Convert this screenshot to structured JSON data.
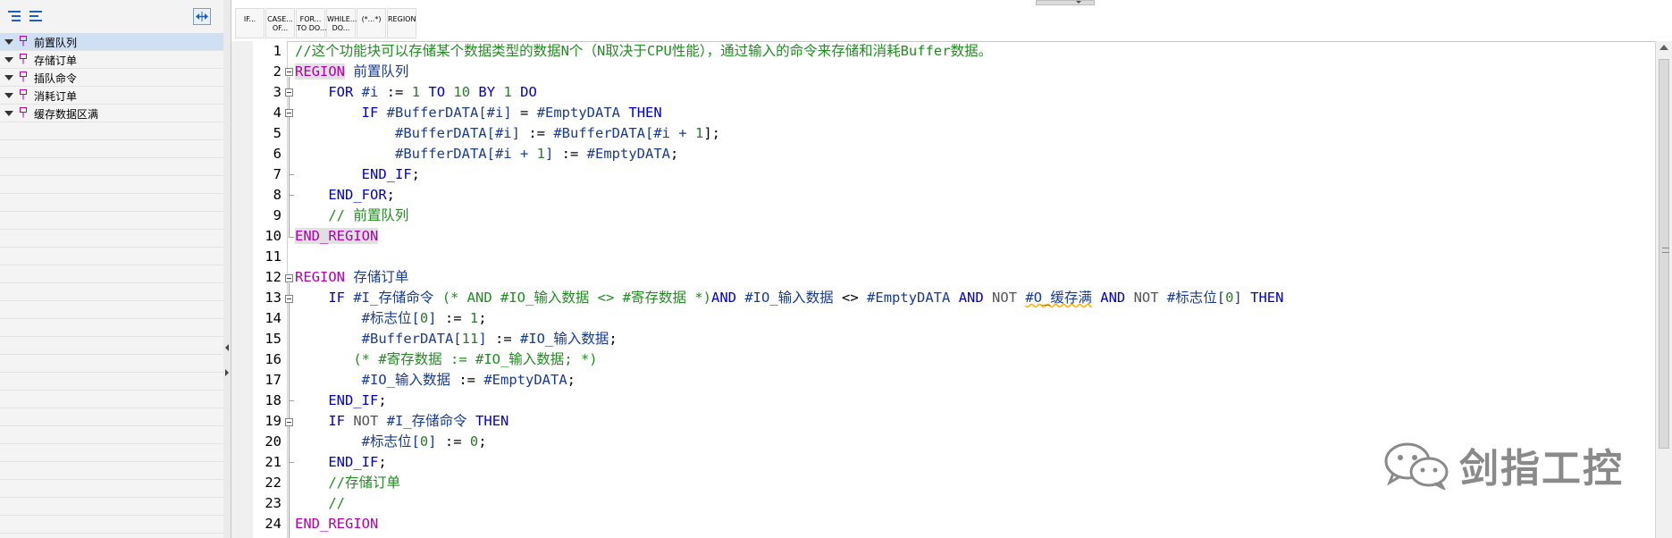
{
  "regions": [
    {
      "label": "前置队列",
      "selected": true
    },
    {
      "label": "存储订单",
      "selected": false
    },
    {
      "label": "插队命令",
      "selected": false
    },
    {
      "label": "消耗订单",
      "selected": false
    },
    {
      "label": "缓存数据区满",
      "selected": false
    }
  ],
  "instructions": [
    "IF...",
    "CASE...\nOF...",
    "FOR...\nTO DO...",
    "WHILE...\nDO...",
    "(*...*)",
    "REGION"
  ],
  "line_numbers": [
    "1",
    "2",
    "3",
    "4",
    "5",
    "6",
    "7",
    "8",
    "9",
    "10",
    "11",
    "12",
    "13",
    "14",
    "15",
    "16",
    "17",
    "18",
    "19",
    "20",
    "21",
    "22",
    "23",
    "24"
  ],
  "code": {
    "l1_comment": "//这个功能块可以存储某个数据类型的数据N个（N取决于CPU性能），通过输入的命令来存储和消耗Buffer数据。",
    "region": "REGION",
    "end_region": "END_REGION",
    "l2_name": " 前置队列",
    "for": "FOR",
    "var_i": "#i",
    "assign": ":=",
    "one": "1",
    "to": "TO",
    "ten": "10",
    "by": "BY",
    "do": "DO",
    "if": "IF",
    "then": "THEN",
    "end_if": "END_IF",
    "end_for": "END_FOR",
    "l4_a": "#BufferDATA[#i]",
    "l4_eq": "=",
    "l4_b": "#EmptyDATA",
    "l5_a": "#BufferDATA[#i]",
    "l5_b": "#BufferDATA[#i + ",
    "l5_c": "];",
    "l6_a": "#BufferDATA[#i + ",
    "l6_b": "]",
    "l6_c": "#EmptyDATA",
    "semi": ";",
    "l9_comment": "// 前置队列",
    "l12_name": " 存储订单",
    "l13_a": "#I_存储命令",
    "l13_cm": "(* AND #IO_输入数据 <> #寄存数据 *)",
    "and": "AND",
    "not": "NOT",
    "l13_b": "#IO_输入数据",
    "l13_ne": "<>",
    "l13_c": "#EmptyDATA",
    "l13_d": "#O_缓存满",
    "l13_e": "#标志位[",
    "zero": "0",
    "close_br": "]",
    "l14_a": "#标志位[",
    "l15_a": "#BufferDATA[",
    "eleven": "11",
    "l15_b": "#IO_输入数据",
    "l16_cm": "(* #寄存数据 := #IO_输入数据; *)",
    "l17_a": "#IO_输入数据",
    "l17_b": "#EmptyDATA",
    "l19_a": "#I_存储命令",
    "l20_a": "#标志位[",
    "l22_comment": "//存储订单",
    "l23_comment": "//"
  },
  "watermark": "剑指工控"
}
